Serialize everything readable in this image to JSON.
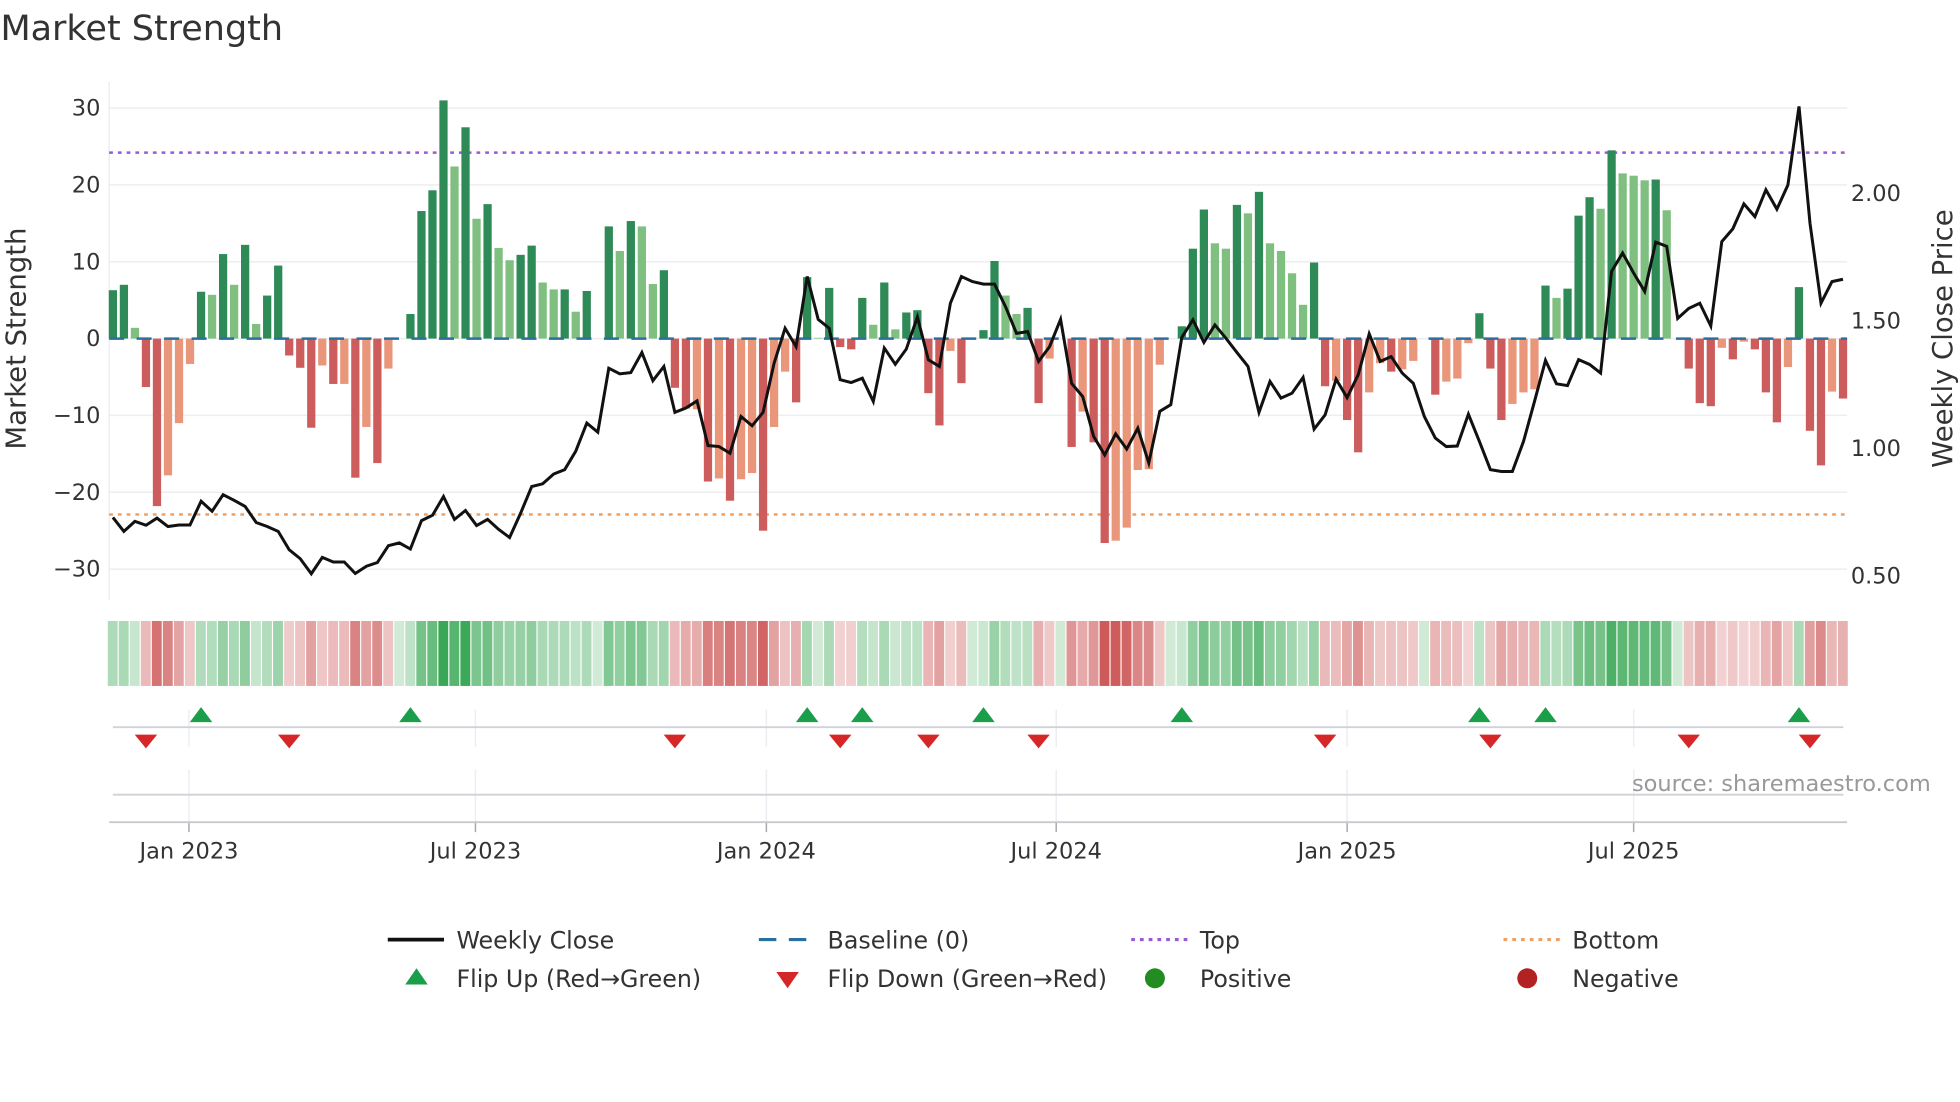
{
  "chart_data": {
    "type": "bar",
    "title": "Market Strength",
    "ylabel": "Market Strength",
    "y2label": "Weekly Close Price",
    "ylim": [
      -33.5,
      34.5
    ],
    "y2lim": [
      0.39,
      2.42
    ],
    "yticks": [
      -30,
      -20,
      -10,
      0,
      10,
      20,
      30
    ],
    "yticks_labels": [
      "−30",
      "−20",
      "−10",
      "0",
      "10",
      "20",
      "30"
    ],
    "y2ticks": [
      0.5,
      1.0,
      1.5,
      2.0
    ],
    "y2ticks_labels": [
      "0.50",
      "1.00",
      "1.50",
      "2.00"
    ],
    "top_level": 24.2,
    "bottom_level": -22.9,
    "baseline": 0,
    "x_unit": "week index (weekly bars)",
    "xticks": [
      {
        "label": "Jan 2023",
        "week": 6.9
      },
      {
        "label": "Jul 2023",
        "week": 32.9
      },
      {
        "label": "Jan 2024",
        "week": 59.3
      },
      {
        "label": "Jul 2024",
        "week": 85.6
      },
      {
        "label": "Jan 2025",
        "week": 112.0
      },
      {
        "label": "Jul 2025",
        "week": 138.0
      }
    ],
    "strength": [
      6.3,
      7,
      1.4,
      -6.3,
      -21.8,
      -17.8,
      -11,
      -3.3,
      6.1,
      5.7,
      11,
      7,
      12.2,
      1.9,
      5.6,
      9.5,
      -2.2,
      -3.8,
      -11.6,
      -3.5,
      -5.9,
      -5.9,
      -18.1,
      -11.5,
      -16.2,
      -3.9,
      0,
      3.2,
      16.6,
      19.3,
      31,
      22.4,
      27.5,
      15.6,
      17.5,
      11.8,
      10.2,
      10.9,
      12.1,
      7.3,
      6.4,
      6.4,
      3.5,
      6.2,
      0,
      14.6,
      11.4,
      15.3,
      14.6,
      7.1,
      8.9,
      -6.4,
      -9.1,
      -9.2,
      -18.6,
      -18.2,
      -21.1,
      -18.3,
      -17.5,
      -25,
      -11.5,
      -4.3,
      -8.3,
      8,
      0.1,
      6.6,
      -1.1,
      -1.4,
      5.3,
      1.8,
      7.3,
      1.2,
      3.4,
      3.7,
      -7.1,
      -11.3,
      -1.6,
      -5.8,
      0,
      1.1,
      10.1,
      5.6,
      3.2,
      4,
      -8.4,
      -2.6,
      0,
      -14.1,
      -9.5,
      -13.5,
      -26.6,
      -26.3,
      -24.6,
      -17.1,
      -17,
      -3.4,
      0,
      1.6,
      11.7,
      16.8,
      12.4,
      11.7,
      17.4,
      16.3,
      19.1,
      12.4,
      11.4,
      8.5,
      4.4,
      9.9,
      -6.2,
      -5.5,
      -10.6,
      -14.8,
      -7,
      -3.2,
      -4.3,
      -4,
      -2.9,
      0,
      -7.3,
      -5.6,
      -5.2,
      -0.6,
      3.3,
      -3.9,
      -10.6,
      -8.5,
      -7,
      -6.6,
      6.9,
      5.3,
      6.5,
      16,
      18.4,
      16.9,
      24.5,
      21.5,
      21.2,
      20.6,
      20.7,
      16.7,
      0,
      -3.9,
      -8.4,
      -8.8,
      -1.2,
      -2.7,
      -0.4,
      -1.4,
      -7,
      -10.9,
      -3.7,
      6.7,
      -12,
      -16.5,
      -6.9,
      -7.8
    ],
    "shade": "DDLDDLLLDLDLDLDDDDDLDLDLDLDDDDDLDLDLLDDLLDLDDDLDLLDDDLDLDLLDLLDDLDDDDLDLDDDDLDDDDLLDDLDDLDDLLLLLDDDDLLDLDLLLLDDLDDLLDLLDDLLLDDDLLLDLDDDLDLLLDLDDDDLDLDDDLDDDLD",
    "weekly_close": [
      0.73,
      0.675,
      0.714,
      0.699,
      0.727,
      0.694,
      0.7,
      0.7,
      0.793,
      0.754,
      0.819,
      0.797,
      0.773,
      0.71,
      0.694,
      0.675,
      0.603,
      0.568,
      0.509,
      0.573,
      0.555,
      0.555,
      0.51,
      0.538,
      0.553,
      0.619,
      0.63,
      0.606,
      0.717,
      0.738,
      0.812,
      0.722,
      0.757,
      0.698,
      0.722,
      0.683,
      0.651,
      0.746,
      0.851,
      0.862,
      0.9,
      0.917,
      0.989,
      1.1,
      1.064,
      1.315,
      1.293,
      1.298,
      1.377,
      1.266,
      1.322,
      1.142,
      1.159,
      1.187,
      1.012,
      1.008,
      0.982,
      1.126,
      1.089,
      1.142,
      1.335,
      1.472,
      1.4,
      1.675,
      1.507,
      1.472,
      1.27,
      1.259,
      1.276,
      1.185,
      1.394,
      1.331,
      1.39,
      1.516,
      1.348,
      1.322,
      1.57,
      1.675,
      1.655,
      1.645,
      1.645,
      1.557,
      1.452,
      1.459,
      1.342,
      1.4,
      1.507,
      1.256,
      1.204,
      1.047,
      0.975,
      1.058,
      0.998,
      1.08,
      0.943,
      1.146,
      1.172,
      1.436,
      1.505,
      1.416,
      1.485,
      1.433,
      1.377,
      1.322,
      1.142,
      1.263,
      1.198,
      1.217,
      1.279,
      1.076,
      1.132,
      1.272,
      1.2,
      1.289,
      1.45,
      1.342,
      1.361,
      1.296,
      1.256,
      1.126,
      1.041,
      1.008,
      1.01,
      1.135,
      1.028,
      0.917,
      0.91,
      0.91,
      1.028,
      1.185,
      1.346,
      1.254,
      1.247,
      1.349,
      1.33,
      1.296,
      1.695,
      1.767,
      1.688,
      1.616,
      1.81,
      1.793,
      1.511,
      1.55,
      1.57,
      1.481,
      1.812,
      1.862,
      1.96,
      1.91,
      2.015,
      1.939,
      2.034,
      2.342,
      1.884,
      1.57,
      1.655,
      1.664
    ],
    "flip_up_weeks": [
      8,
      27,
      63,
      68,
      79,
      97,
      124,
      130,
      153
    ],
    "flip_down_weeks": [
      3,
      16,
      51,
      66,
      74,
      84,
      110,
      125,
      143,
      154
    ],
    "legend": {
      "placement": "bottom",
      "items": [
        {
          "label": "Weekly Close",
          "kind": "line"
        },
        {
          "label": "Baseline (0)",
          "kind": "dash"
        },
        {
          "label": "Top",
          "kind": "dotted-purple"
        },
        {
          "label": "Bottom",
          "kind": "dotted-orange"
        },
        {
          "label": "Flip Up (Red→Green)",
          "kind": "triangle-up"
        },
        {
          "label": "Flip Down (Green→Red)",
          "kind": "triangle-down"
        },
        {
          "label": "Positive",
          "kind": "dot-green"
        },
        {
          "label": "Negative",
          "kind": "dot-red"
        }
      ]
    },
    "source": "source: sharemaestro.com",
    "colors": {
      "pos_dark": "#2e8b57",
      "pos_light": "#7fbf7f",
      "neg_dark": "#cd5c5c",
      "neg_light": "#e9967a",
      "close": "#111111",
      "baseline": "#2a6f9e",
      "top": "#9b59d6",
      "bottom": "#f0a060",
      "flip_up": "#1a9e4a",
      "flip_down": "#d62728",
      "positive": "#228b22",
      "negative": "#b22222",
      "grid": "#eceef3"
    }
  }
}
